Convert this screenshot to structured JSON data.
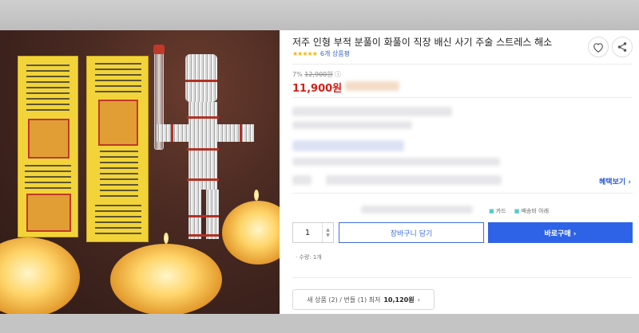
{
  "product": {
    "title": "저주 인형 부적 분풀이 화풀이 직장 배신 사기 주술 스트레스 해소",
    "stars": "★★★★★",
    "review_link": "6개 상품평",
    "discount_label": "7%",
    "original_price": "12,900원",
    "price": "11,900원"
  },
  "actions": {
    "wishlist_icon": "heart-icon",
    "share_icon": "share-icon",
    "benefit_label": "혜택보기 ›",
    "card_label": "카드",
    "delivery_label": "배송비 아래"
  },
  "purchase": {
    "quantity": "1",
    "cart_label": "장바구니 담기",
    "buy_label": "바로구매 ›",
    "selected_text": "· 수량: 1개"
  },
  "seller": {
    "prefix": "새 상품 (2) / 번들 (1) 최저",
    "lowest_price": "10,120원",
    "suffix": "›"
  },
  "colors": {
    "price_red": "#d4201a",
    "accent_blue": "#2e63e8",
    "star_gold": "#ffb400"
  }
}
